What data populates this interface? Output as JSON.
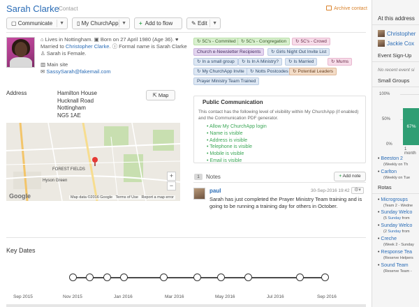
{
  "header": {
    "name": "Sarah Clarke",
    "type": "Contact",
    "archive": "Archive contact"
  },
  "toolbar": {
    "communicate": "Communicate",
    "church_app": "My ChurchApp",
    "add_to_flow": "Add to flow",
    "edit": "Edit"
  },
  "profile": {
    "lives_in": "Lives in Nottingham.",
    "born": "Born on 27 April 1980 (Age 36).",
    "married_prefix": "Married to",
    "spouse": "Christopher Clarke",
    "formal_name": "Formal name is Sarah Clarke.",
    "gender": "Sarah is Female.",
    "site": "Main site",
    "email": "SassySarah@fakemail.com"
  },
  "tags": [
    {
      "label": "5C's - Commited",
      "color": "green"
    },
    {
      "label": "5C's - Congregation",
      "color": "green"
    },
    {
      "label": "5C's - Crowd",
      "color": "pink"
    },
    {
      "label": "Church e-Newsletter Recipients",
      "color": "purple"
    },
    {
      "label": "Girls Night Out Invite List",
      "color": "blue"
    },
    {
      "label": "In a small group",
      "color": "blue"
    },
    {
      "label": "Is In A Ministry?",
      "color": "blue"
    },
    {
      "label": "Is Married",
      "color": "blue"
    },
    {
      "label": "Mums",
      "color": "pink"
    },
    {
      "label": "My ChurchApp Invite",
      "color": "blue"
    },
    {
      "label": "Notts Postcodes",
      "color": "blue"
    },
    {
      "label": "Potential Leaders",
      "color": "orange"
    },
    {
      "label": "Prayer Ministry Team Trained",
      "color": "blue"
    }
  ],
  "address": {
    "label": "Address",
    "lines": [
      "Hamilton House",
      "Hucknall Road",
      "Nottingham",
      "NG5 1AE"
    ],
    "map_button": "Map"
  },
  "map": {
    "forest_fields": "FOREST FIELDS",
    "hyson_green": "Hyson Green",
    "google": "Google",
    "attribution": [
      "Map data ©2016 Google",
      "Terms of Use",
      "Report a map error"
    ],
    "zoom_in": "+",
    "zoom_out": "−"
  },
  "public_comm": {
    "title": "Public Communication",
    "description": "This contact has the following level of visibility within My ChurchApp (if enabled) and the Communication PDF generator.",
    "items": [
      "Allow My ChurchApp login",
      "Name is visible",
      "Address is visible",
      "Telephone is visible",
      "Mobile is visible",
      "Email is visible"
    ]
  },
  "notes": {
    "count": "1",
    "title": "Notes",
    "add_label": "Add note",
    "items": [
      {
        "author": "paul",
        "date": "30-Sep-2016 19:42",
        "text": "Sarah has just completed the Prayer Ministry Team training and is going to be running a training day for others in October."
      }
    ]
  },
  "key_dates": {
    "title": "Key Dates",
    "axis_labels": [
      "Sep 2015",
      "Nov 2015",
      "Jan 2016",
      "Mar 2016",
      "May 2016",
      "Jul 2016",
      "Sep 2016"
    ]
  },
  "sidebar": {
    "heading": "At this address",
    "people": [
      "Christopher",
      "Jackie Cox"
    ],
    "event_signup": "Event Sign-Up",
    "no_events": "No recent event si",
    "small_groups": "Small Groups",
    "chart": {
      "value_label": "67%",
      "ticks": [
        "100%",
        "50%",
        "0%"
      ],
      "xlabel": "1 month"
    },
    "groups": [
      {
        "name": "Beeston 2",
        "detail": "(Weekly on Th"
      },
      {
        "name": "Carlton",
        "detail": "(Weekly on Tue"
      }
    ],
    "rotas_label": "Rotas",
    "rotas": [
      {
        "name": "Microgroups",
        "detail": "(Team 2 - Wedne"
      },
      {
        "name": "Sunday Welco",
        "detail_prefix": "(5",
        "detail_link": "Sunday",
        "detail_suffix": " from"
      },
      {
        "name": "Sunday Welco",
        "detail_prefix": "(2",
        "detail_link": "Sunday",
        "detail_suffix": " from"
      },
      {
        "name": "Creche",
        "detail": "(Week 2 - Sunday"
      },
      {
        "name": "Response Tea",
        "detail": "(Reserve Helpers"
      },
      {
        "name": "Sound Team",
        "detail": "(Reserve Team -"
      }
    ]
  }
}
